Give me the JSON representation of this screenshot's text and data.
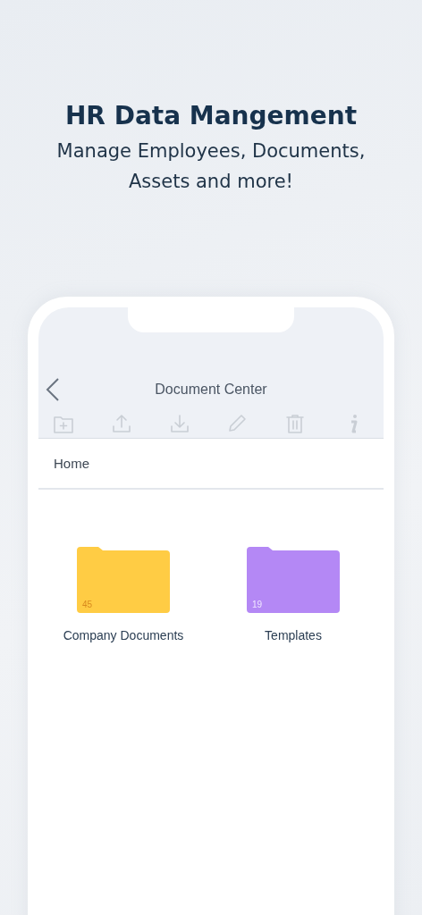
{
  "headline": "HR Data Mangement",
  "subtitle": "Manage Employees, Documents, Assets and more!",
  "app": {
    "title": "Document Center",
    "toolbar": [
      {
        "kind": "new-folder",
        "disabled": true
      },
      {
        "kind": "upload",
        "disabled": true
      },
      {
        "kind": "download",
        "disabled": true
      },
      {
        "kind": "edit",
        "disabled": true
      },
      {
        "kind": "delete",
        "disabled": true
      },
      {
        "kind": "info",
        "disabled": true
      }
    ],
    "breadcrumb": "Home",
    "folders": [
      {
        "name": "Company Documents",
        "count": "45",
        "color": "#ffcc44"
      },
      {
        "name": "Templates",
        "count": "19",
        "color": "#b488f5"
      }
    ]
  }
}
